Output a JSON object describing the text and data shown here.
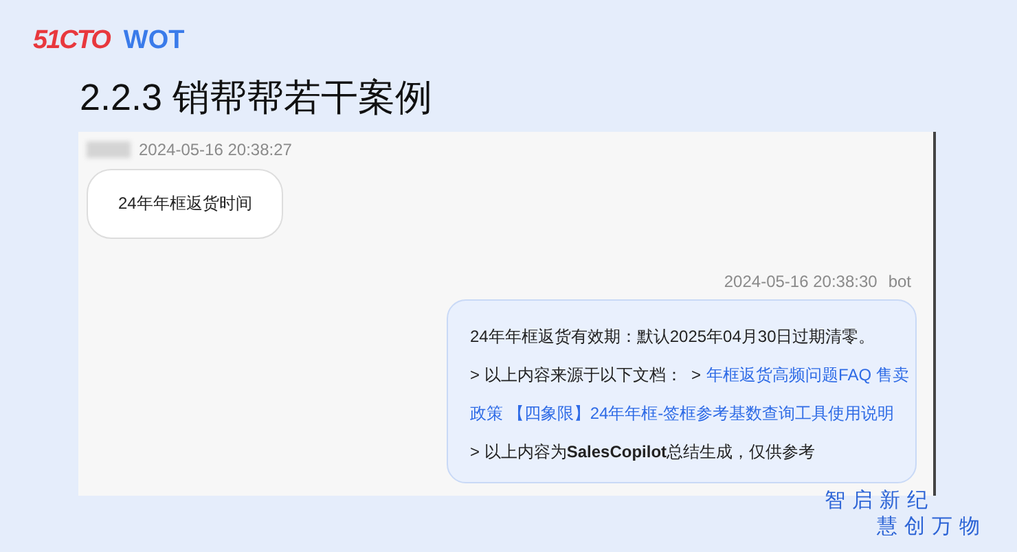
{
  "logo": {
    "brand": "51CTO",
    "event": "WOT"
  },
  "title": "2.2.3 销帮帮若干案例",
  "chat": {
    "messages": [
      {
        "kind": "user",
        "time": "2024-05-16 20:38:27",
        "text": "24年年框返货时间"
      },
      {
        "kind": "bot",
        "time": "2024-05-16 20:38:30",
        "sender": "bot",
        "answer": "24年年框返货有效期：默认2025年04月30日过期清零。",
        "source_prefix": "> 以上内容来源于以下文档：  >",
        "source_links": [
          "年框返货高频问题FAQ 售卖",
          "政策 【四象限】24年年框-签框参考基数查询工具使用说明"
        ],
        "note": "> 以上内容为**SalesCopilot**总结生成，仅供参考"
      }
    ]
  },
  "footer": {
    "slogan": [
      "智启新纪",
      "慧创万物"
    ]
  }
}
